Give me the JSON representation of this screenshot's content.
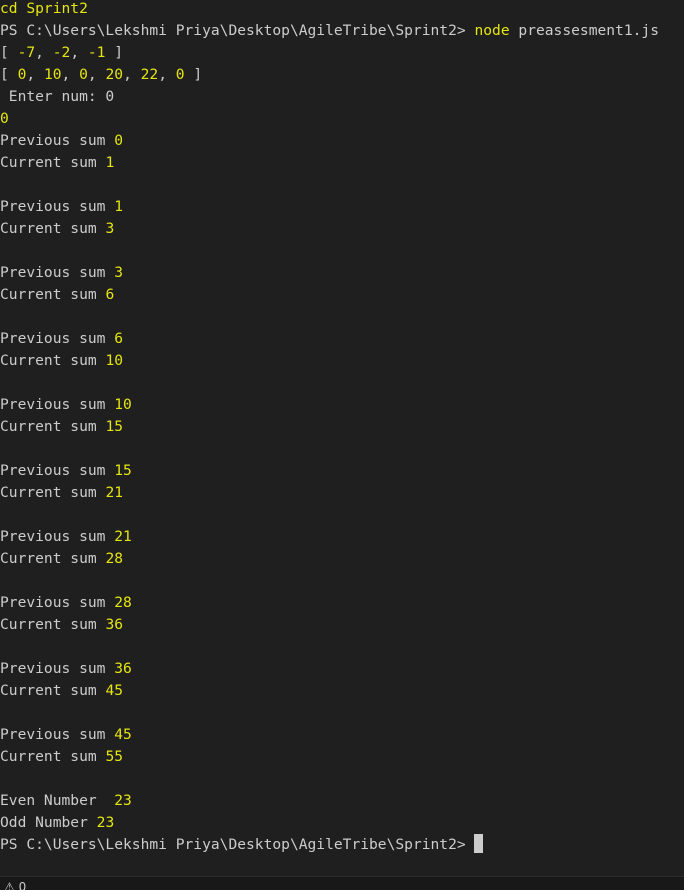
{
  "terminal": {
    "lines": [
      [
        [
          "cd Sprint2",
          "y"
        ]
      ],
      [
        [
          "PS C:\\Users\\Lekshmi Priya\\Desktop\\AgileTribe\\Sprint2> ",
          "w"
        ],
        [
          "node",
          "y"
        ],
        [
          " preassesment1.js",
          "w"
        ]
      ],
      [
        [
          "[ ",
          "w"
        ],
        [
          "-7",
          "y"
        ],
        [
          ", ",
          "w"
        ],
        [
          "-2",
          "y"
        ],
        [
          ", ",
          "w"
        ],
        [
          "-1",
          "y"
        ],
        [
          " ]",
          "w"
        ]
      ],
      [
        [
          "[ ",
          "w"
        ],
        [
          "0",
          "y"
        ],
        [
          ", ",
          "w"
        ],
        [
          "10",
          "y"
        ],
        [
          ", ",
          "w"
        ],
        [
          "0",
          "y"
        ],
        [
          ", ",
          "w"
        ],
        [
          "20",
          "y"
        ],
        [
          ", ",
          "w"
        ],
        [
          "22",
          "y"
        ],
        [
          ", ",
          "w"
        ],
        [
          "0",
          "y"
        ],
        [
          " ]",
          "w"
        ]
      ],
      [
        [
          " Enter num: 0",
          "w"
        ]
      ],
      [
        [
          "0",
          "y"
        ]
      ],
      [
        [
          "Previous sum ",
          "w"
        ],
        [
          "0",
          "y"
        ]
      ],
      [
        [
          "Current sum ",
          "w"
        ],
        [
          "1",
          "y"
        ]
      ],
      [],
      [
        [
          "Previous sum ",
          "w"
        ],
        [
          "1",
          "y"
        ]
      ],
      [
        [
          "Current sum ",
          "w"
        ],
        [
          "3",
          "y"
        ]
      ],
      [],
      [
        [
          "Previous sum ",
          "w"
        ],
        [
          "3",
          "y"
        ]
      ],
      [
        [
          "Current sum ",
          "w"
        ],
        [
          "6",
          "y"
        ]
      ],
      [],
      [
        [
          "Previous sum ",
          "w"
        ],
        [
          "6",
          "y"
        ]
      ],
      [
        [
          "Current sum ",
          "w"
        ],
        [
          "10",
          "y"
        ]
      ],
      [],
      [
        [
          "Previous sum ",
          "w"
        ],
        [
          "10",
          "y"
        ]
      ],
      [
        [
          "Current sum ",
          "w"
        ],
        [
          "15",
          "y"
        ]
      ],
      [],
      [
        [
          "Previous sum ",
          "w"
        ],
        [
          "15",
          "y"
        ]
      ],
      [
        [
          "Current sum ",
          "w"
        ],
        [
          "21",
          "y"
        ]
      ],
      [],
      [
        [
          "Previous sum ",
          "w"
        ],
        [
          "21",
          "y"
        ]
      ],
      [
        [
          "Current sum ",
          "w"
        ],
        [
          "28",
          "y"
        ]
      ],
      [],
      [
        [
          "Previous sum ",
          "w"
        ],
        [
          "28",
          "y"
        ]
      ],
      [
        [
          "Current sum ",
          "w"
        ],
        [
          "36",
          "y"
        ]
      ],
      [],
      [
        [
          "Previous sum ",
          "w"
        ],
        [
          "36",
          "y"
        ]
      ],
      [
        [
          "Current sum ",
          "w"
        ],
        [
          "45",
          "y"
        ]
      ],
      [],
      [
        [
          "Previous sum ",
          "w"
        ],
        [
          "45",
          "y"
        ]
      ],
      [
        [
          "Current sum ",
          "w"
        ],
        [
          "55",
          "y"
        ]
      ],
      [],
      [
        [
          "Even Number  ",
          "w"
        ],
        [
          "23",
          "y"
        ]
      ],
      [
        [
          "Odd Number ",
          "w"
        ],
        [
          "23",
          "y"
        ]
      ],
      [
        [
          "PS C:\\Users\\Lekshmi Priya\\Desktop\\AgileTribe\\Sprint2> ",
          "w"
        ]
      ]
    ]
  },
  "statusbar": {
    "warning_count": "0",
    "warning_icon": "warning-icon"
  },
  "colors": {
    "background": "#1f1f1f",
    "text": "#cccccc",
    "highlight": "#e5e510"
  }
}
